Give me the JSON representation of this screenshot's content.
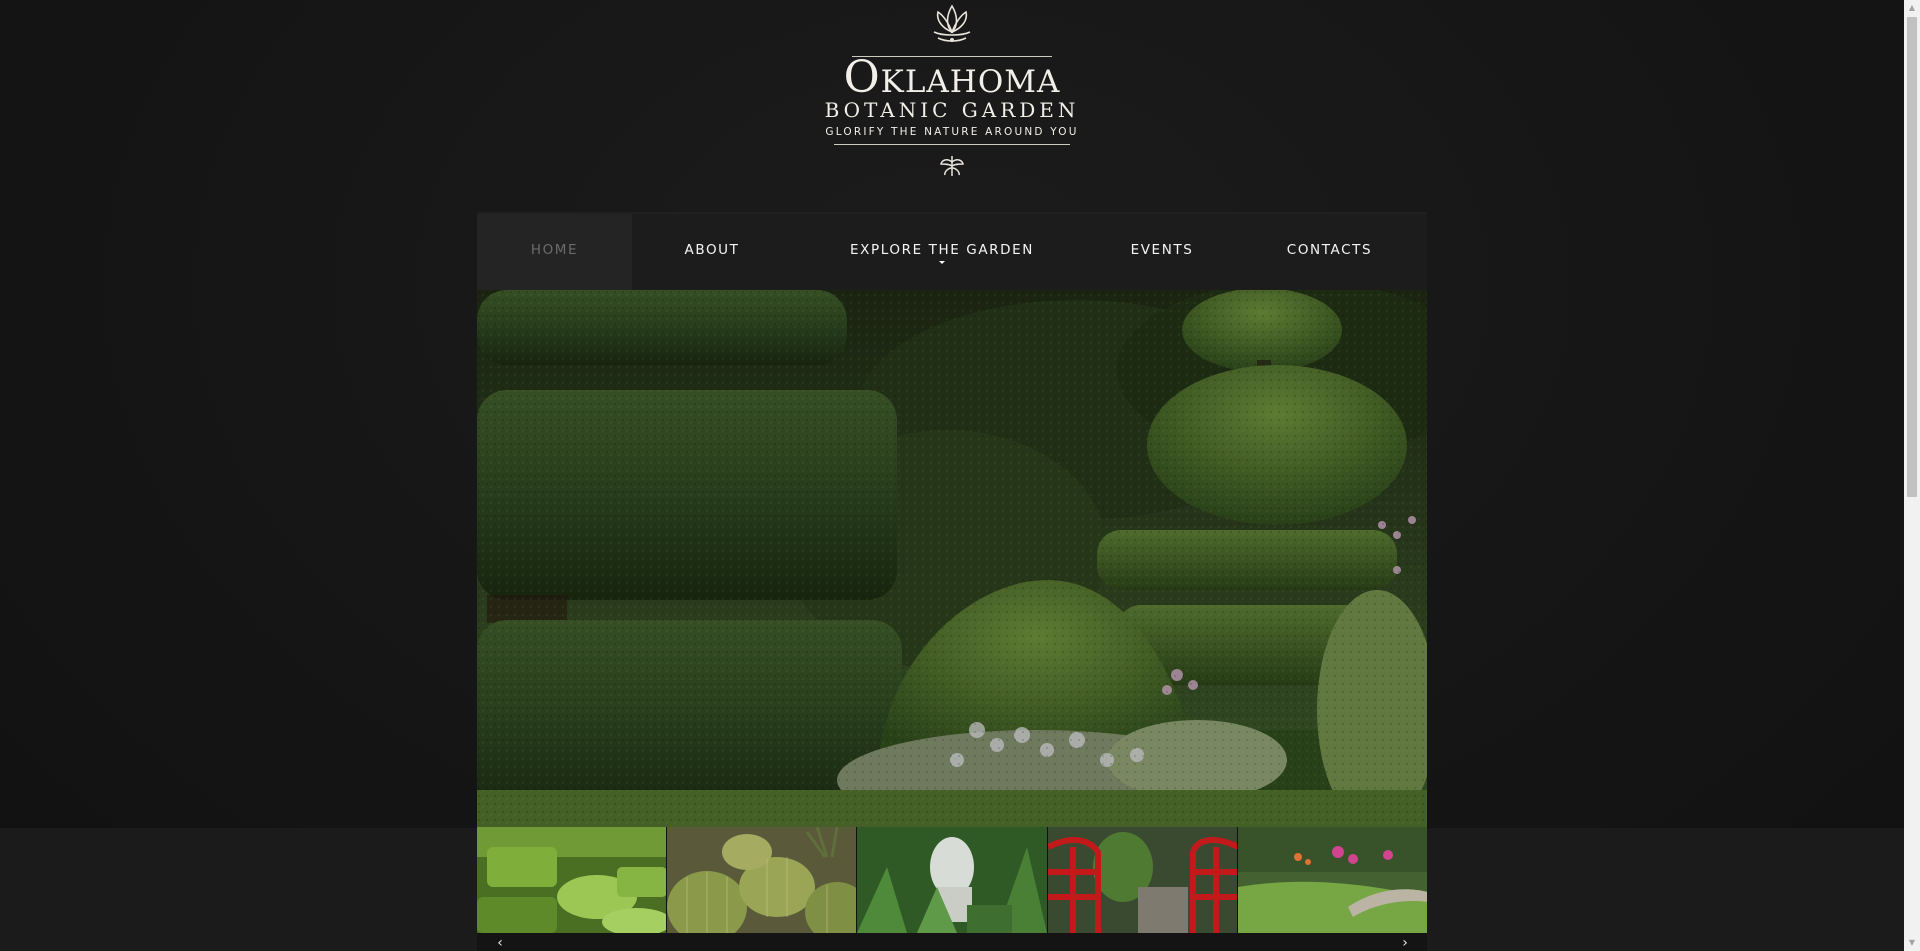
{
  "logo": {
    "title": "Oklahoma",
    "subtitle": "BOTANIC GARDEN",
    "tagline": "GLORIFY THE NATURE AROUND YOU",
    "ornament_icon": "lotus-ornament-icon",
    "bottom_ornament_icon": "fleur-ornament-icon"
  },
  "nav": {
    "items": [
      {
        "label": "HOME",
        "active": true
      },
      {
        "label": "ABOUT"
      },
      {
        "label": "EXPLORE THE GARDEN",
        "has_dropdown": true
      },
      {
        "label": "EVENTS"
      },
      {
        "label": "CONTACTS"
      }
    ]
  },
  "slider": {
    "thumbnails": [
      "topiary-garden",
      "barrel-cactus",
      "white-statue",
      "red-bridge",
      "flower-lawn"
    ],
    "prev_icon": "chevron-left-icon",
    "next_icon": "chevron-right-icon"
  },
  "colors": {
    "background": "#161616",
    "nav_background": "#1c1c1c",
    "nav_active": "#242424",
    "logo_text": "#f2efe8"
  }
}
